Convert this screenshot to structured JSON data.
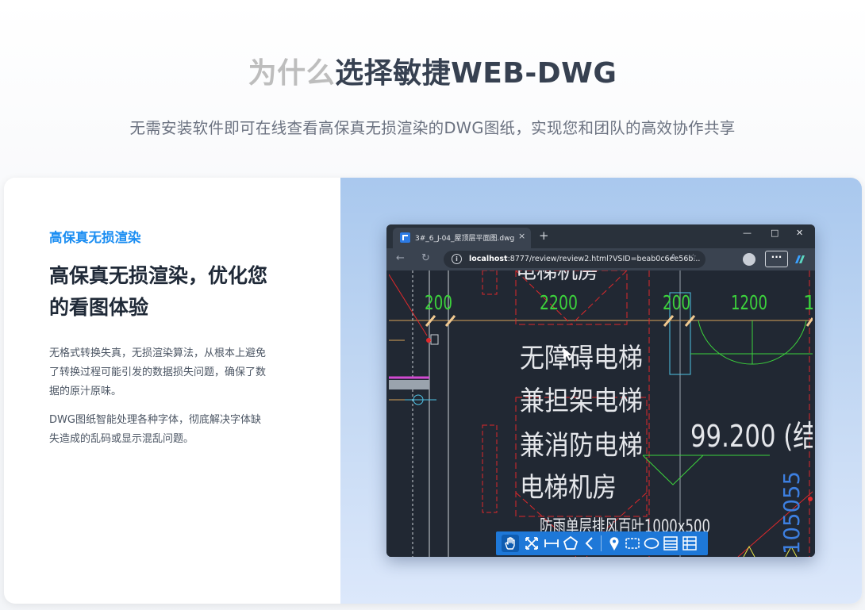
{
  "hero": {
    "title_light": "为什么",
    "title_dark": "选择敏捷WEB-DWG",
    "subtitle": "无需安装软件即可在线查看高保真无损渲染的DWG图纸，实现您和团队的高效协作共享"
  },
  "feature": {
    "tag": "高保真无损渲染",
    "title_line1": "高保真无损渲染，优化您",
    "title_line2": "的看图体验",
    "paragraph1_line1": "无格式转换失真，无损渲染算法，从根本上避免",
    "paragraph1_line2": "了转换过程可能引发的数据损失问题，确保了数",
    "paragraph1_line3": "据的原汁原味。",
    "paragraph2_line1": "DWG图纸智能处理各种字体，彻底解决字体缺",
    "paragraph2_line2": "失造成的乱码或显示混乱问题。"
  },
  "browser": {
    "tab_title": "3#_6_J-04_屋顶层平面图.dwg",
    "tab_close": "×",
    "new_tab": "+",
    "minimize": "—",
    "maximize": "□",
    "close": "✕",
    "url_host": "localhost",
    "url_rest": ":8777/review/review2.html?VSID=beab0c6ee56b...",
    "read_aloud": "A",
    "more": "···"
  },
  "drawing": {
    "dim_200_left": "200",
    "dim_2200": "2200",
    "dim_200_right": "200",
    "dim_1200": "1200",
    "dim_1_partial": "1",
    "header_partial": "电梯机房",
    "text_line1": "无障碍电梯",
    "text_line2": "兼担架电梯",
    "text_line3": "兼消防电梯",
    "text_line4": "电梯机房",
    "elevation": "99.200 (结",
    "vertical_dim": "105055",
    "louver": "防雨单层排风百叶1000x500"
  },
  "toolbar": {
    "tools": [
      "pan-hand",
      "zoom-extents",
      "measure",
      "polygon",
      "back",
      "location-pin",
      "rectangle",
      "ellipse",
      "layers",
      "list"
    ]
  },
  "colors": {
    "accent": "#1a8df2",
    "cad_background": "#212833",
    "cad_red": "#e0282b",
    "cad_green": "#3cd23c",
    "cad_cyan": "#4fc3e6",
    "toolbar_blue": "#1e78d8"
  }
}
